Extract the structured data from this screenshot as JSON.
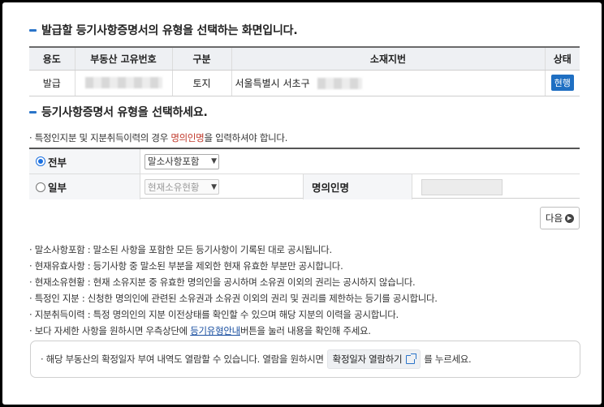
{
  "headings": {
    "h1": "발급할 등기사항증명서의 유형을 선택하는 화면입니다.",
    "h2": "등기사항증명서 유형을 선택하세요."
  },
  "info_table": {
    "headers": [
      "용도",
      "부동산 고유번호",
      "구분",
      "소재지번",
      "상태"
    ],
    "row": {
      "purpose": "발급",
      "kind": "토지",
      "address": "서울특별시 서초구",
      "status": "현행"
    }
  },
  "note": {
    "prefix": "· 특정인지분 및 지분취득이력의 경우 ",
    "highlight": "명의인명",
    "suffix": "을 입력하셔야 합니다."
  },
  "options": {
    "full": {
      "label": "전부",
      "selected": true,
      "select_value": "말소사항포함"
    },
    "partial": {
      "label": "일부",
      "selected": false,
      "select_value": "현재소유현황",
      "name_label": "명의인명",
      "name_value": ""
    }
  },
  "next_button": "다음",
  "bullets": [
    {
      "text": "· 말소사항포함 : 말소된 사항을 포함한 모든 등기사항이 기록된 대로 공시됩니다."
    },
    {
      "text": "· 현재유효사항 : 등기사항 중 말소된 부분을 제외한 현재 유효한 부분만 공시합니다."
    },
    {
      "text": "· 현재소유현황 : 현재 소유지분 중 유효한 명의인을 공시하며 소유권 이외의 권리는 공시하지 않습니다."
    },
    {
      "text": "· 특정인 지분 : 신청한 명의인에 관련된 소유권과 소유권 이외의 권리 및 권리를 제한하는 등기를 공시합니다."
    },
    {
      "text": "· 지분취득이력 : 특정 명의인의 지분 이전상태를 확인할 수 있으며 해당 지분의 이력을 공시합니다."
    }
  ],
  "last_bullet": {
    "prefix": "· 보다 자세한 사항을 원하시면 우측상단에 ",
    "link": "등기유형안내",
    "suffix": "버튼을 눌러 내용을 확인해 주세요."
  },
  "info_box": {
    "prefix": "· 해당 부동산의 확정일자 부여 내역도 열람할 수 있습니다. 열람을 원하시면",
    "button": "확정일자 열람하기",
    "suffix": "를 누르세요."
  },
  "colors": {
    "accent": "#2a74c9",
    "status_badge": "#1f6fc2",
    "highlight": "#c0392b"
  }
}
